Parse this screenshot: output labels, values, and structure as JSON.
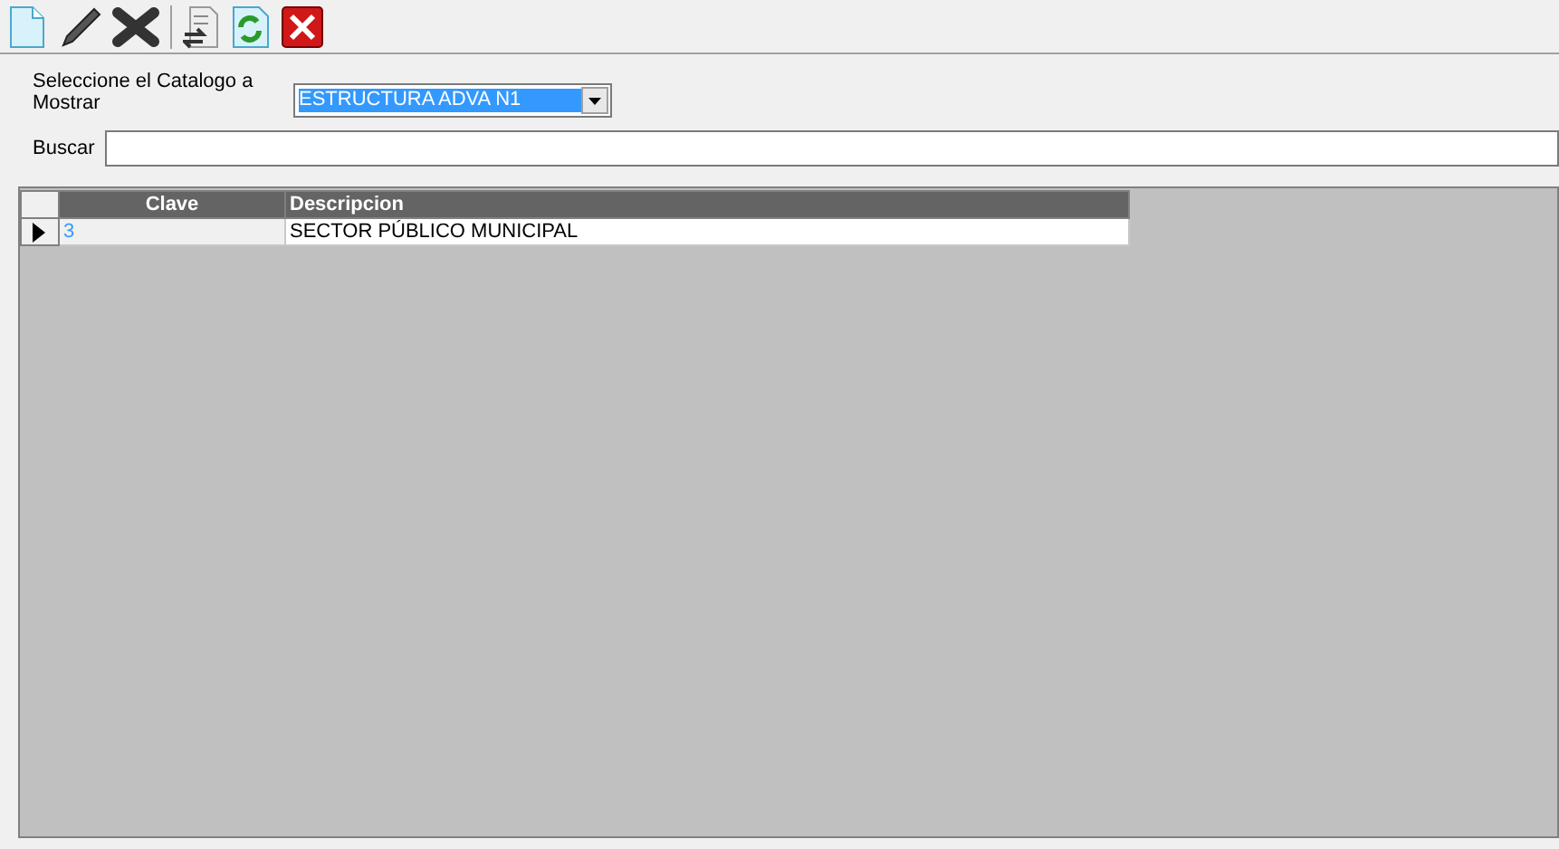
{
  "toolbar": [
    {
      "kind": "new"
    },
    {
      "kind": "edit"
    },
    {
      "kind": "delete"
    },
    {
      "kind": "separator"
    },
    {
      "kind": "export"
    },
    {
      "kind": "refresh"
    },
    {
      "kind": "close"
    }
  ],
  "catalog_select": {
    "label": "Seleccione el Catalogo a Mostrar",
    "value": "ESTRUCTURA ADVA N1"
  },
  "search": {
    "label": "Buscar"
  },
  "table": {
    "columns": [
      "Clave",
      "Descripcion"
    ],
    "rows": [
      {
        "selected": true,
        "cells": [
          "3",
          "SECTOR PÚBLICO MUNICIPAL"
        ]
      }
    ]
  }
}
